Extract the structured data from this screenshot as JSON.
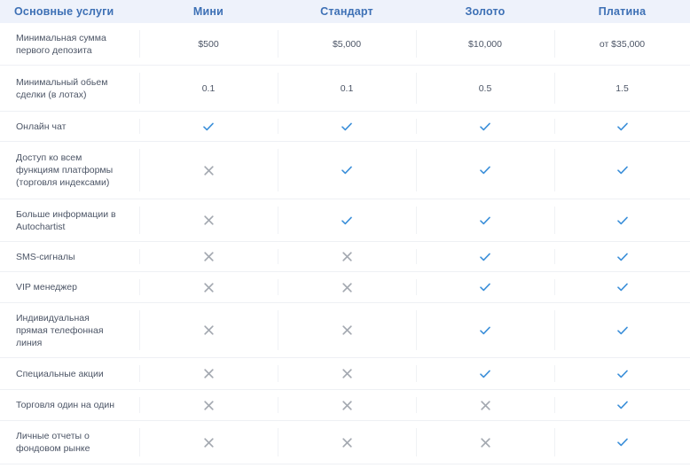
{
  "header": {
    "features": "Основные услуги",
    "plans": [
      "Мини",
      "Стандарт",
      "Золото",
      "Платина"
    ]
  },
  "rows": [
    {
      "feature": "Минимальная сумма\nпервого депозита",
      "values": [
        "$500",
        "$5,000",
        "$10,000",
        "от $35,000"
      ]
    },
    {
      "feature": "Минимальный обьем\nсделки (в лотах)",
      "values": [
        "0.1",
        "0.1",
        "0.5",
        "1.5"
      ]
    },
    {
      "feature": "Онлайн чат",
      "values": [
        "check",
        "check",
        "check",
        "check"
      ]
    },
    {
      "feature": "Доступ ко всем\nфункциям платформы\n(торговля индексами)",
      "values": [
        "cross",
        "check",
        "check",
        "check"
      ]
    },
    {
      "feature": "Больше информации в\nAutochartist",
      "values": [
        "cross",
        "check",
        "check",
        "check"
      ]
    },
    {
      "feature": "SMS-сигналы",
      "values": [
        "cross",
        "cross",
        "check",
        "check"
      ]
    },
    {
      "feature": "VIP менеджер",
      "values": [
        "cross",
        "cross",
        "check",
        "check"
      ]
    },
    {
      "feature": "Индивидуальная\nпрямая телефонная\nлиния",
      "values": [
        "cross",
        "cross",
        "check",
        "check"
      ]
    },
    {
      "feature": "Специальные акции",
      "values": [
        "cross",
        "cross",
        "check",
        "check"
      ]
    },
    {
      "feature": "Торговля один на один",
      "values": [
        "cross",
        "cross",
        "cross",
        "check"
      ]
    },
    {
      "feature": "Личные отчеты о\nфондовом рынке",
      "values": [
        "cross",
        "cross",
        "cross",
        "check"
      ]
    }
  ],
  "colors": {
    "header_bg": "#eef2fb",
    "header_text": "#3d70b5",
    "check": "#3b8fd9",
    "cross": "#a3a8b0"
  }
}
